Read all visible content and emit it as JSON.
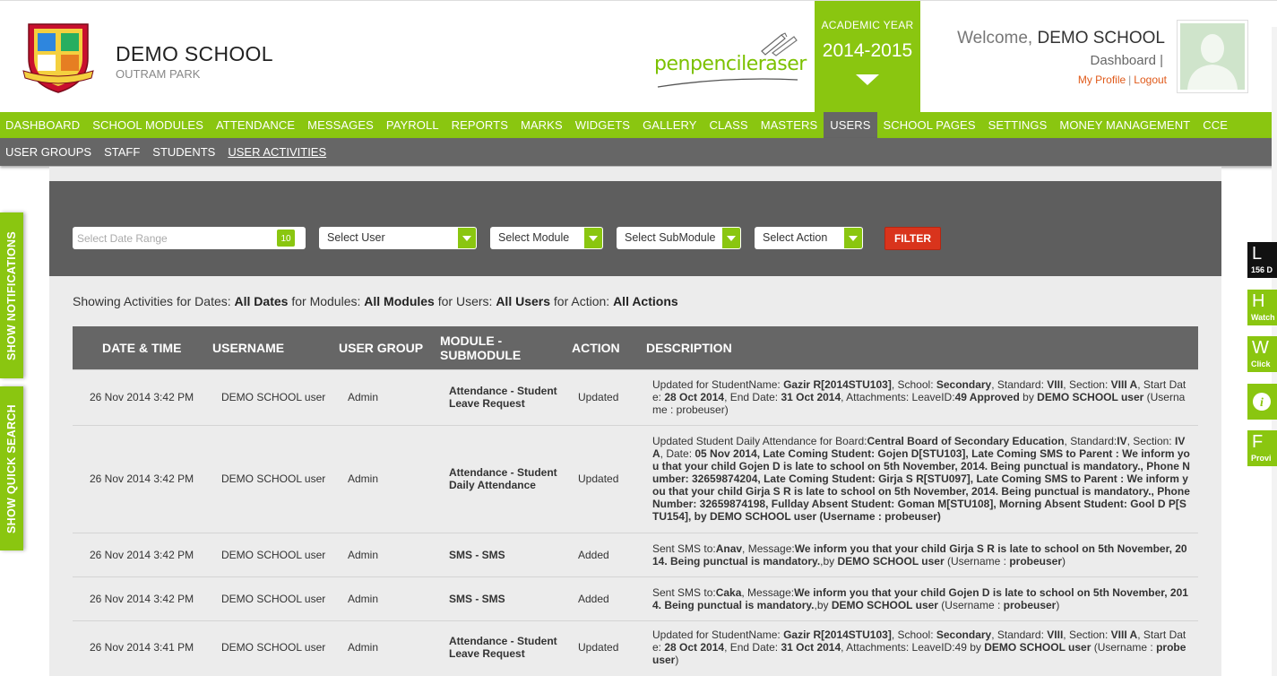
{
  "header": {
    "school_name": "DEMO SCHOOL",
    "school_location": "OUTRAM PARK",
    "brand": "penpencileraser",
    "academic_year_label": "ACADEMIC YEAR",
    "academic_year": "2014-2015",
    "welcome_prefix": "Welcome,",
    "welcome_name": "DEMO SCHOOL",
    "dashboard_link": "Dashboard |",
    "my_profile": "My Profile",
    "separator": "|",
    "logout": "Logout"
  },
  "nav": [
    "DASHBOARD",
    "SCHOOL MODULES",
    "ATTENDANCE",
    "MESSAGES",
    "PAYROLL",
    "REPORTS",
    "MARKS",
    "WIDGETS",
    "GALLERY",
    "CLASS",
    "MASTERS",
    "USERS",
    "SCHOOL PAGES",
    "SETTINGS",
    "MONEY MANAGEMENT",
    "CCE"
  ],
  "nav_active": "USERS",
  "subnav": [
    "USER GROUPS",
    "STAFF",
    "STUDENTS",
    "USER ACTIVITIES"
  ],
  "subnav_active": "USER ACTIVITIES",
  "filters": {
    "date_placeholder": "Select Date Range",
    "calendar_day": "10",
    "user": "Select User",
    "module": "Select Module",
    "submodule": "Select SubModule",
    "action": "Select Action",
    "filter_button": "FILTER"
  },
  "showing": {
    "p1": "Showing Activities for Dates: ",
    "dates": "All Dates",
    "p2": " for Modules: ",
    "modules": "All Modules",
    "p3": " for Users: ",
    "users": "All Users",
    "p4": " for Action: ",
    "actions": "All Actions"
  },
  "table": {
    "headers": {
      "datetime": "DATE & TIME",
      "username": "USERNAME",
      "group": "USER GROUP",
      "module": "MODULE - SUBMODULE",
      "action": "ACTION",
      "description": "DESCRIPTION"
    },
    "rows": [
      {
        "datetime": "26 Nov 2014 3:42 PM",
        "username": "DEMO SCHOOL user",
        "group": "Admin",
        "module": "Attendance - Student Leave Request",
        "action": "Updated",
        "description": [
          {
            "t": "Updated for StudentName: "
          },
          {
            "t": "Gazir R[2014STU103]",
            "b": true
          },
          {
            "t": ", School: "
          },
          {
            "t": "Secondary",
            "b": true
          },
          {
            "t": ", Standard: "
          },
          {
            "t": "VIII",
            "b": true
          },
          {
            "t": ", Section: "
          },
          {
            "t": "VIII A",
            "b": true
          },
          {
            "t": ", Start Date: "
          },
          {
            "t": "28 Oct 2014",
            "b": true
          },
          {
            "t": ", End Date: "
          },
          {
            "t": "31 Oct 2014",
            "b": true
          },
          {
            "t": ", Attachments: LeaveID:"
          },
          {
            "t": "49 Approved",
            "b": true
          },
          {
            "t": " by "
          },
          {
            "t": "DEMO SCHOOL user",
            "b": true
          },
          {
            "t": " (Username : probeuser)"
          }
        ]
      },
      {
        "datetime": "26 Nov 2014 3:42 PM",
        "username": "DEMO SCHOOL user",
        "group": "Admin",
        "module": "Attendance - Student Daily Attendance",
        "action": "Updated",
        "description": [
          {
            "t": "Updated Student Daily Attendance for Board:"
          },
          {
            "t": "Central Board of Secondary Education",
            "b": true
          },
          {
            "t": ", Standard:"
          },
          {
            "t": "IV",
            "b": true
          },
          {
            "t": ", Section: "
          },
          {
            "t": "IV A",
            "b": true
          },
          {
            "t": ", Date: "
          },
          {
            "t": "05 Nov 2014, Late Coming Student: Gojen D[STU103], Late Coming SMS to Parent : We inform you that your child Gojen D is late to school on 5th November, 2014. Being punctual is mandatory., Phone Number: 32659874204, Late Coming Student: Girja S R[STU097], Late Coming SMS to Parent : We inform you that your child Girja S R is late to school on 5th November, 2014. Being punctual is mandatory., Phone Number: 32659874198, Fullday Absent Student: Goman M[STU108], Morning Absent Student: Gool D P[STU154], by DEMO SCHOOL user (Username : probeuser)",
            "b": true
          }
        ]
      },
      {
        "datetime": "26 Nov 2014 3:42 PM",
        "username": "DEMO SCHOOL user",
        "group": "Admin",
        "module": "SMS - SMS",
        "action": "Added",
        "description": [
          {
            "t": "Sent SMS to:"
          },
          {
            "t": "Anav",
            "b": true
          },
          {
            "t": ", Message:"
          },
          {
            "t": "We inform you that your child Girja S R is late to school on 5th November, 2014. Being punctual is mandatory.",
            "b": true
          },
          {
            "t": ",by "
          },
          {
            "t": "DEMO SCHOOL user",
            "b": true
          },
          {
            "t": " (Username : "
          },
          {
            "t": "probeuser",
            "b": true
          },
          {
            "t": ")"
          }
        ]
      },
      {
        "datetime": "26 Nov 2014 3:42 PM",
        "username": "DEMO SCHOOL user",
        "group": "Admin",
        "module": "SMS - SMS",
        "action": "Added",
        "description": [
          {
            "t": "Sent SMS to:"
          },
          {
            "t": "Caka",
            "b": true
          },
          {
            "t": ", Message:"
          },
          {
            "t": "We inform you that your child Gojen D is late to school on 5th November, 2014. Being punctual is mandatory.",
            "b": true
          },
          {
            "t": ",by "
          },
          {
            "t": "DEMO SCHOOL user",
            "b": true
          },
          {
            "t": " (Username : "
          },
          {
            "t": "probeuser",
            "b": true
          },
          {
            "t": ")"
          }
        ]
      },
      {
        "datetime": "26 Nov 2014 3:41 PM",
        "username": "DEMO SCHOOL user",
        "group": "Admin",
        "module": "Attendance - Student Leave Request",
        "action": "Updated",
        "description": [
          {
            "t": "Updated for StudentName: "
          },
          {
            "t": "Gazir R[2014STU103]",
            "b": true
          },
          {
            "t": ", School: "
          },
          {
            "t": "Secondary",
            "b": true
          },
          {
            "t": ", Standard: "
          },
          {
            "t": "VIII",
            "b": true
          },
          {
            "t": ", Section: "
          },
          {
            "t": "VIII A",
            "b": true
          },
          {
            "t": ", Start Date: "
          },
          {
            "t": "28 Oct 2014",
            "b": true
          },
          {
            "t": ", End Date: "
          },
          {
            "t": "31 Oct 2014",
            "b": true
          },
          {
            "t": ", Attachments: LeaveID:49 by "
          },
          {
            "t": "DEMO SCHOOL user",
            "b": true
          },
          {
            "t": " (Username : "
          },
          {
            "t": "probeuser",
            "b": true
          },
          {
            "t": ")"
          }
        ]
      }
    ]
  },
  "side_tabs": {
    "notifications": "SHOW NOTIFICATIONS",
    "quick_search": "SHOW QUICK SEARCH"
  },
  "right_widgets": [
    {
      "letter": "L",
      "sub": "156 D",
      "bg": "#111111"
    },
    {
      "letter": "H",
      "sub": "Watch",
      "bg": "#8ac610"
    },
    {
      "letter": "W",
      "sub": "Click",
      "bg": "#8ac610"
    },
    {
      "letter": "i",
      "sub": "",
      "bg": "#8ac610"
    },
    {
      "letter": "F",
      "sub": "Provi",
      "bg": "#8ac610"
    }
  ],
  "colors": {
    "accent_green": "#8ac610",
    "nav_dark": "#666666",
    "filter_red": "#d9341c",
    "link_orange": "#e05a1a"
  }
}
